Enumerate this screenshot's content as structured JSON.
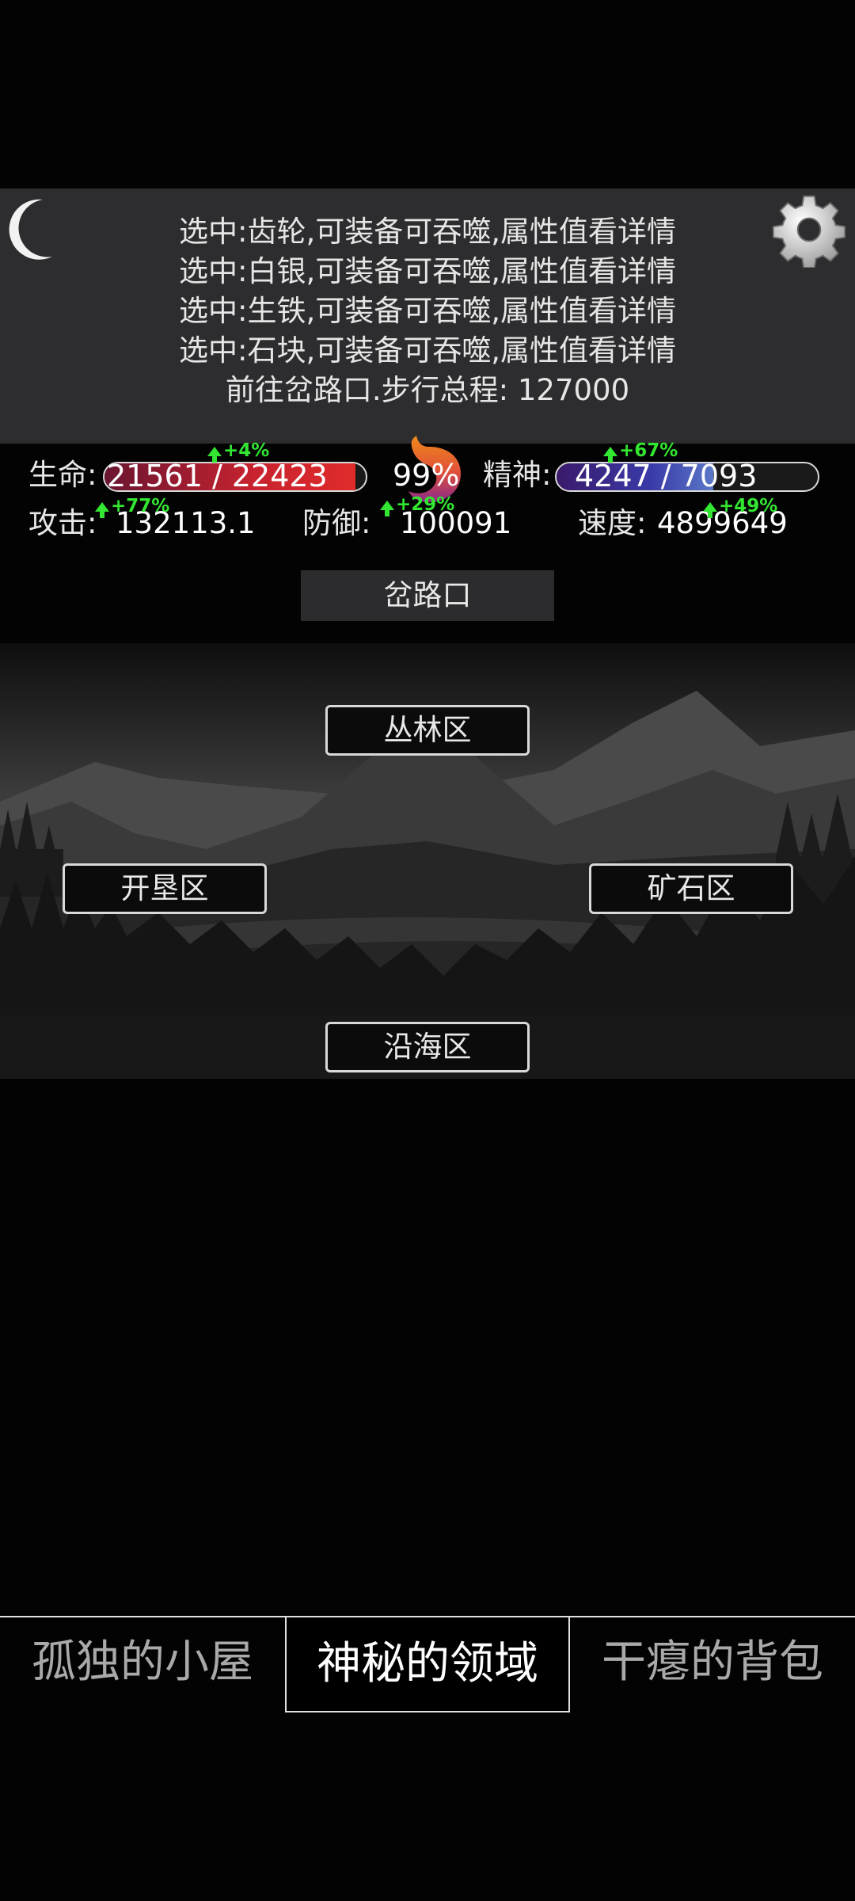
{
  "log": {
    "lines": [
      "选中:齿轮,可装备可吞噬,属性值看详情",
      "选中:白银,可装备可吞噬,属性值看详情",
      "选中:生铁,可装备可吞噬,属性值看详情",
      "选中:石块,可装备可吞噬,属性值看详情",
      "前往岔路口.步行总程: 127000"
    ]
  },
  "icons": {
    "moon": "crescent-moon-icon",
    "settings": "gear-icon",
    "hunger": "stomach-icon",
    "boost": "green-up-arrow-icon"
  },
  "stats": {
    "hp": {
      "label": "生命:",
      "text": "21561 / 22423",
      "value": 21561,
      "max": 22423,
      "boost": "+4%",
      "color": "#c8232f"
    },
    "hunger": {
      "percent_text": "99%",
      "percent": 99,
      "boost": "+29%"
    },
    "spirit": {
      "label": "精神:",
      "text": "4247 / 7093",
      "value": 4247,
      "max": 7093,
      "boost": "+67%",
      "color": "#4a2aa0"
    },
    "attack": {
      "label": "攻击:",
      "value": "132113.1",
      "boost": "+77%"
    },
    "defense": {
      "label": "防御:",
      "value": "100091"
    },
    "speed": {
      "label": "速度:",
      "value": "4899649",
      "boost": "+49%"
    }
  },
  "location": {
    "name": "岔路口"
  },
  "map": {
    "zones": {
      "north": "丛林区",
      "west": "开垦区",
      "east": "矿石区",
      "south": "沿海区"
    }
  },
  "tabs": {
    "left": "孤独的小屋",
    "center": "神秘的领域",
    "right": "干瘪的背包",
    "active": "center"
  }
}
